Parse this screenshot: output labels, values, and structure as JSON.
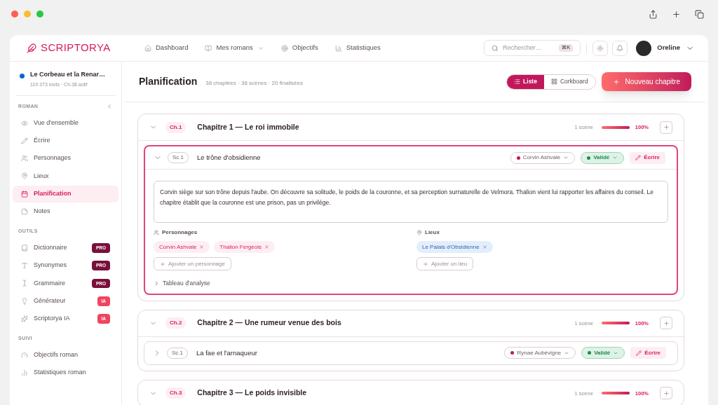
{
  "brand": "SCRIPTORYA",
  "nav": [
    {
      "label": "Dashboard",
      "dropdown": false
    },
    {
      "label": "Mes romans",
      "dropdown": true
    },
    {
      "label": "Objectifs",
      "dropdown": false
    },
    {
      "label": "Statistiques",
      "dropdown": false
    }
  ],
  "search": {
    "placeholder": "Rechercher…",
    "shortcut": "⌘K"
  },
  "user": {
    "name": "Oreline"
  },
  "project": {
    "title": "Le Corbeau et la Renar…",
    "meta": "119 373 mots · Ch.38 actif",
    "color": "#0a63d6"
  },
  "sidebar": [
    {
      "heading": "ROMAN",
      "items": [
        {
          "label": "Vue d'ensemble",
          "selected": false
        },
        {
          "label": "Écrire",
          "selected": false
        },
        {
          "label": "Personnages",
          "selected": false
        },
        {
          "label": "Lieux",
          "selected": false
        },
        {
          "label": "Planification",
          "selected": true
        },
        {
          "label": "Notes",
          "selected": false
        }
      ]
    },
    {
      "heading": "OUTILS",
      "items": [
        {
          "label": "Dictionnaire",
          "selected": false,
          "badge": {
            "text": "PRO",
            "kind": "pro"
          }
        },
        {
          "label": "Synonymes",
          "selected": false,
          "badge": {
            "text": "PRO",
            "kind": "pro"
          }
        },
        {
          "label": "Grammaire",
          "selected": false,
          "badge": {
            "text": "PRO",
            "kind": "pro"
          }
        },
        {
          "label": "Générateur",
          "selected": false,
          "badge": {
            "text": "IA",
            "kind": "ia"
          }
        },
        {
          "label": "Scriptorya IA",
          "selected": false,
          "badge": {
            "text": "IA",
            "kind": "ia"
          }
        }
      ]
    },
    {
      "heading": "SUIVI",
      "items": [
        {
          "label": "Objectifs roman",
          "selected": false
        },
        {
          "label": "Statistiques roman",
          "selected": false
        }
      ]
    }
  ],
  "page": {
    "title": "Planification",
    "meta": "38 chapitres · 38 scènes · 20 finalisées"
  },
  "views": [
    {
      "label": "Liste",
      "selected": true
    },
    {
      "label": "Corkboard",
      "selected": false
    }
  ],
  "new_button": "Nouveau chapitre",
  "chapters": [
    {
      "tag": "Ch.1",
      "title": "Chapitre 1 — Le roi immobile",
      "expanded": true,
      "count": "1 scène",
      "level": 1,
      "percent": "100%",
      "scenes": [
        {
          "tag": "Sc.1",
          "title": "Le trône d'obsidienne",
          "expanded": true,
          "pov": {
            "name": "Corvin Ashvale",
            "color": "#c2185b"
          },
          "status": {
            "label": "Validé",
            "color": "#1e8a4c"
          },
          "write": "Écrire",
          "summary": "Corvin siège sur son trône depuis l'aube. On découvre sa solitude, le poids de la couronne, et sa perception surnaturelle de Velmora. Thalion vient lui rapporter les affaires du conseil. Le chapitre établit que la couronne est une prison, pas un privilège.",
          "characters_label": "Personnages",
          "characters": [
            "Corvin Ashvale",
            "Thalion Fergeois"
          ],
          "add_character": "Ajouter un personnage",
          "places_label": "Lieux",
          "places": [
            "Le Palais d'Obsidienne"
          ],
          "add_place": "Ajouter un lieu",
          "analysis": "Tableau d'analyse"
        }
      ]
    },
    {
      "tag": "Ch.2",
      "title": "Chapitre 2 — Une rumeur venue des bois",
      "expanded": true,
      "count": "1 scène",
      "level": 1,
      "percent": "100%",
      "scenes": [
        {
          "tag": "Sc.1",
          "title": "La fae et l'arnaqueur",
          "expanded": false,
          "pov": {
            "name": "Rynae Aubévigne",
            "color": "#c2185b"
          },
          "status": {
            "label": "Validé",
            "color": "#1e8a4c"
          },
          "write": "Écrire"
        }
      ]
    },
    {
      "tag": "Ch.3",
      "title": "Chapitre 3 — Le poids invisible",
      "expanded": true,
      "count": "1 scène",
      "level": 1,
      "percent": "100%"
    }
  ]
}
